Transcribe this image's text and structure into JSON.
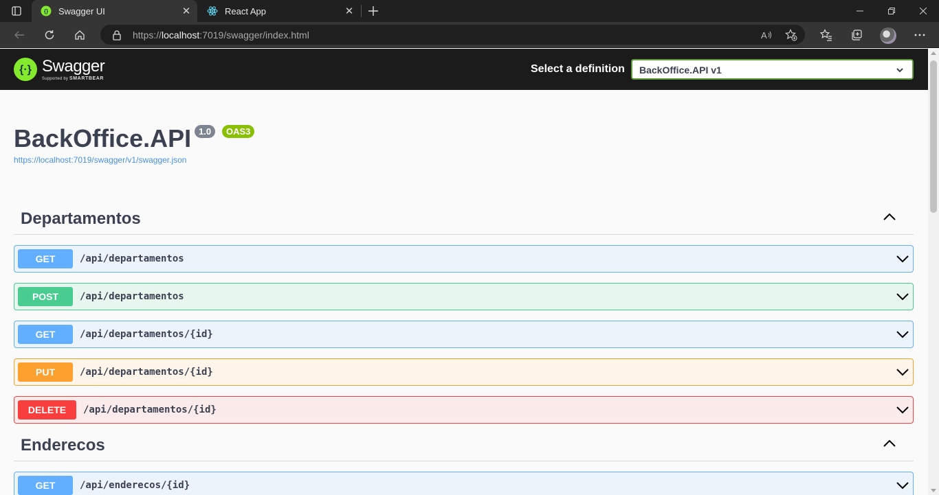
{
  "browser": {
    "tabs": [
      {
        "title": "Swagger UI",
        "active": true,
        "favicon": "swagger-icon"
      },
      {
        "title": "React App",
        "active": false,
        "favicon": "react-icon"
      }
    ],
    "address": {
      "scheme": "https://",
      "host": "localhost",
      "rest": ":7019/swagger/index.html"
    }
  },
  "topbar": {
    "brand": "Swagger",
    "brand_sub_prefix": "Supported by",
    "brand_sub_name": "SMARTBEAR",
    "definition_label": "Select a definition",
    "definition_value": "BackOffice.API v1"
  },
  "info": {
    "title": "BackOffice.API",
    "version": "1.0",
    "oas": "OAS3",
    "spec_url": "https://localhost:7019/swagger/v1/swagger.json"
  },
  "tags": [
    {
      "name": "Departamentos",
      "operations": [
        {
          "method": "GET",
          "path": "/api/departamentos"
        },
        {
          "method": "POST",
          "path": "/api/departamentos"
        },
        {
          "method": "GET",
          "path": "/api/departamentos/{id}"
        },
        {
          "method": "PUT",
          "path": "/api/departamentos/{id}"
        },
        {
          "method": "DELETE",
          "path": "/api/departamentos/{id}"
        }
      ]
    },
    {
      "name": "Enderecos",
      "operations": [
        {
          "method": "GET",
          "path": "/api/enderecos/{id}"
        }
      ]
    }
  ],
  "colors": {
    "get": "#61affe",
    "post": "#49cc90",
    "put": "#fca130",
    "delete": "#f93e3e",
    "brand_green": "#85ea2d"
  }
}
